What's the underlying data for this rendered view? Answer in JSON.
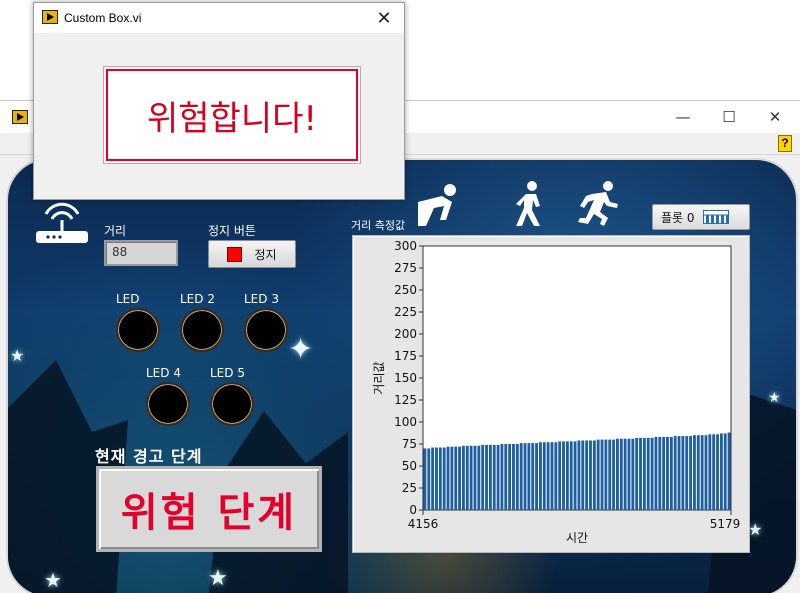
{
  "dialog": {
    "title": "Custom Box.vi",
    "close_label": "✕",
    "message": "위험합니다!"
  },
  "main_window": {
    "minimize_label": "—",
    "maximize_label": "☐",
    "close_label": "✕"
  },
  "panel": {
    "distance_label": "거리",
    "distance_value": "88",
    "stop_label": "정지 버튼",
    "stop_button_text": "정지",
    "leds": [
      {
        "label": "LED",
        "state": "off"
      },
      {
        "label": "LED 2",
        "state": "off"
      },
      {
        "label": "LED 3",
        "state": "off"
      },
      {
        "label": "LED 4",
        "state": "off"
      },
      {
        "label": "LED 5",
        "state": "off"
      }
    ],
    "warning_title": "현재 경고 단계",
    "warning_level": "위험 단계",
    "plot_legend": "플롯 0",
    "chart_label": "거리 측정값"
  },
  "colors": {
    "bar": "#1f5fa0",
    "warning_text": "#e4002b",
    "stop_indicator": "#ff0000"
  },
  "chart_data": {
    "type": "bar",
    "xlabel": "시간",
    "ylabel": "거리값",
    "x_range": [
      4156,
      5179
    ],
    "ylim": [
      0,
      300
    ],
    "yticks": [
      0,
      25,
      50,
      75,
      100,
      125,
      150,
      175,
      200,
      225,
      250,
      275,
      300
    ],
    "xtick_labels": [
      "4156",
      "5179"
    ],
    "series": [
      {
        "values": [
          70,
          70,
          71,
          71,
          71,
          71,
          72,
          72,
          72,
          72,
          73,
          73,
          73,
          73,
          73,
          74,
          74,
          74,
          74,
          74,
          75,
          75,
          75,
          75,
          75,
          76,
          76,
          76,
          76,
          76,
          77,
          77,
          77,
          77,
          77,
          78,
          78,
          78,
          78,
          78,
          79,
          79,
          79,
          79,
          79,
          80,
          80,
          80,
          80,
          80,
          81,
          81,
          81,
          81,
          81,
          82,
          82,
          82,
          82,
          82,
          83,
          83,
          83,
          83,
          83,
          84,
          84,
          84,
          84,
          84,
          85,
          85,
          85,
          85,
          86,
          86,
          86,
          87,
          87,
          88
        ]
      }
    ]
  }
}
